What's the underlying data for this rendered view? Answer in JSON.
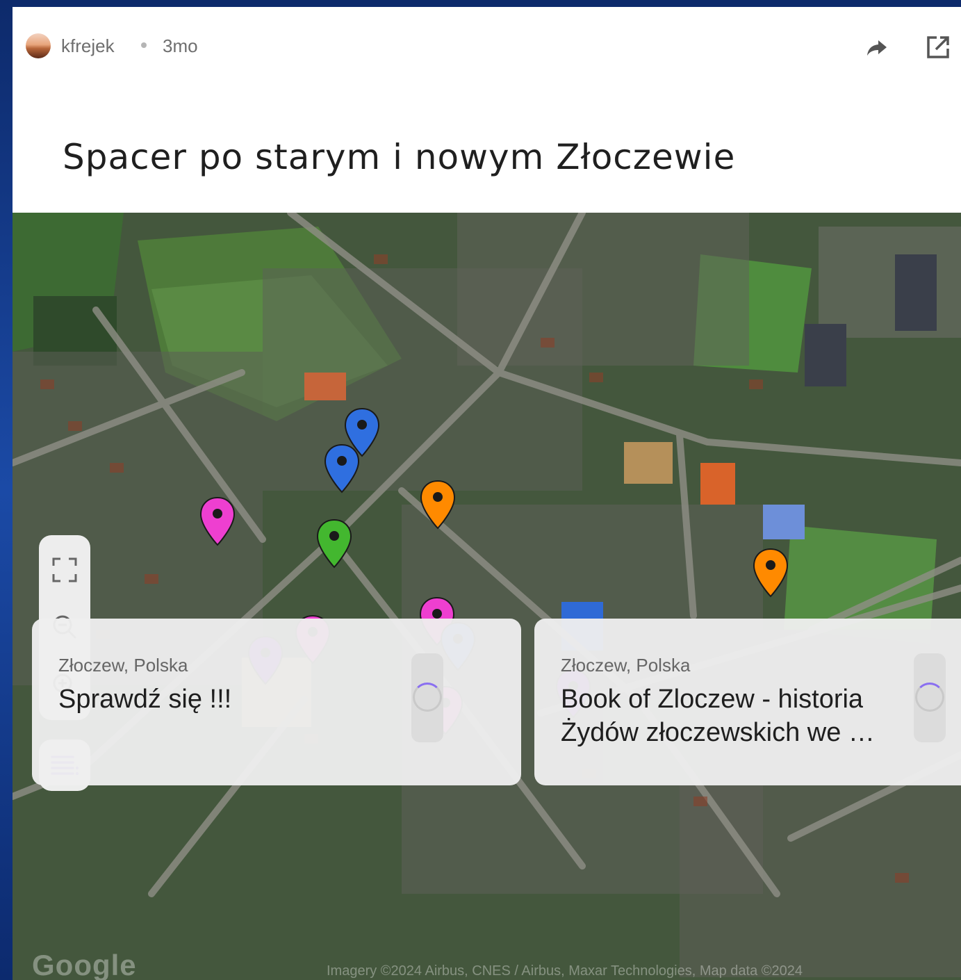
{
  "post": {
    "author": "kfrejek",
    "age": "3mo",
    "title": "Spacer po starym i nowym Złoczewie"
  },
  "icons": {
    "share": "share-arrow-icon",
    "open": "open-external-icon",
    "fullscreen": "fullscreen-icon",
    "zoom_out": "zoom-out-icon",
    "zoom_in": "zoom-in-icon",
    "legend": "list-legend-icon"
  },
  "map": {
    "markers": [
      {
        "color": "#2f6fe0",
        "label": "blue"
      },
      {
        "color": "#2f6fe0",
        "label": "blue"
      },
      {
        "color": "#ee3fd0",
        "label": "pink"
      },
      {
        "color": "#43b72f",
        "label": "green"
      },
      {
        "color": "#ff8a00",
        "label": "orange"
      },
      {
        "color": "#ff8a00",
        "label": "orange"
      },
      {
        "color": "#ee3fd0",
        "label": "pink"
      },
      {
        "color": "#2f6fe0",
        "label": "blue"
      },
      {
        "color": "#8a16e8",
        "label": "purple"
      },
      {
        "color": "#ee3fd0",
        "label": "pink"
      },
      {
        "color": "#ee3fd0",
        "label": "pink"
      },
      {
        "color": "#8a16e8",
        "label": "purple"
      }
    ],
    "watermark": "Google",
    "attribution": "Imagery ©2024 Airbus, CNES / Airbus, Maxar Technologies, Map data ©2024"
  },
  "cards": [
    {
      "location": "Złoczew, Polska",
      "title": "Sprawdź się !!!"
    },
    {
      "location": "Złoczew, Polska",
      "title": "Book of Zloczew - historia Żydów złoczewskich we …"
    }
  ]
}
